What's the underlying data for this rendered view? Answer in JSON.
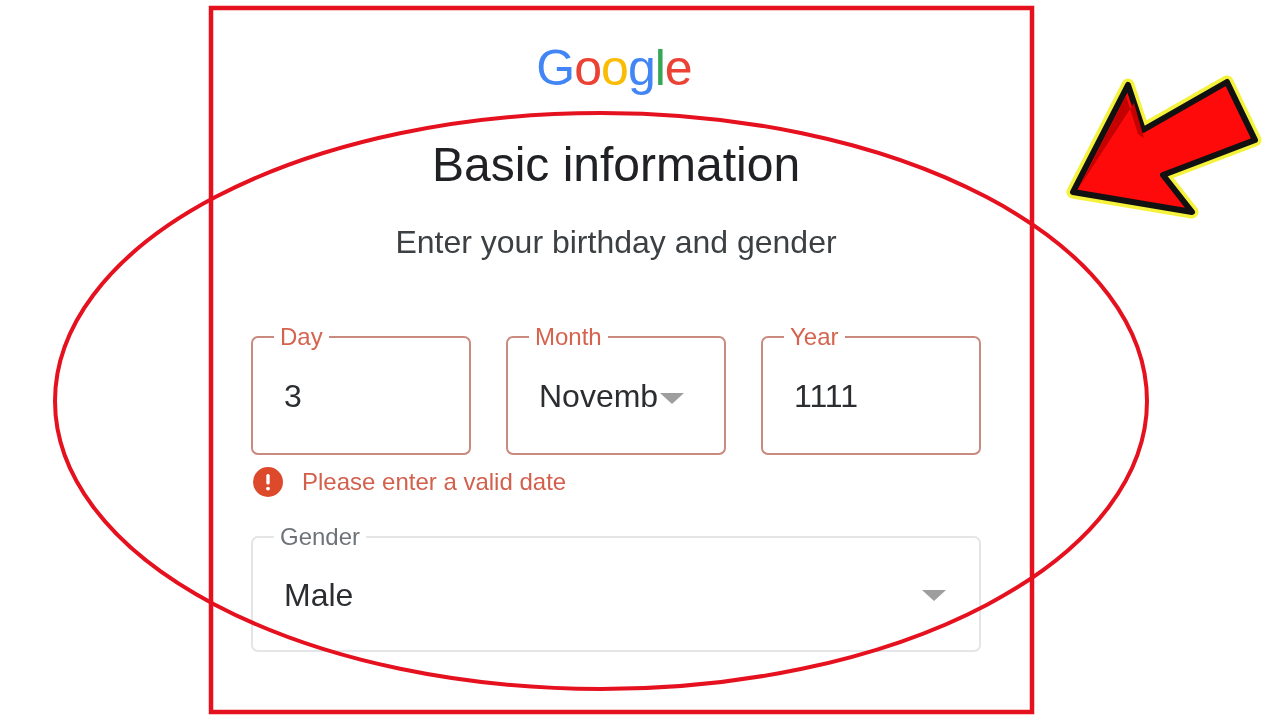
{
  "logo": {
    "text": "Google"
  },
  "heading": {
    "title": "Basic information",
    "subtitle": "Enter your birthday and gender"
  },
  "date_fields": [
    {
      "kind": "text",
      "label": "Day",
      "value": "3",
      "invalid": true
    },
    {
      "kind": "dropdown",
      "label": "Month",
      "value": "Novemb",
      "invalid": true
    },
    {
      "kind": "text",
      "label": "Year",
      "value": "1111",
      "invalid": true
    }
  ],
  "error_message": "Please enter a valid date",
  "gender_field": {
    "kind": "dropdown",
    "label": "Gender",
    "value": "Male",
    "invalid": false
  }
}
